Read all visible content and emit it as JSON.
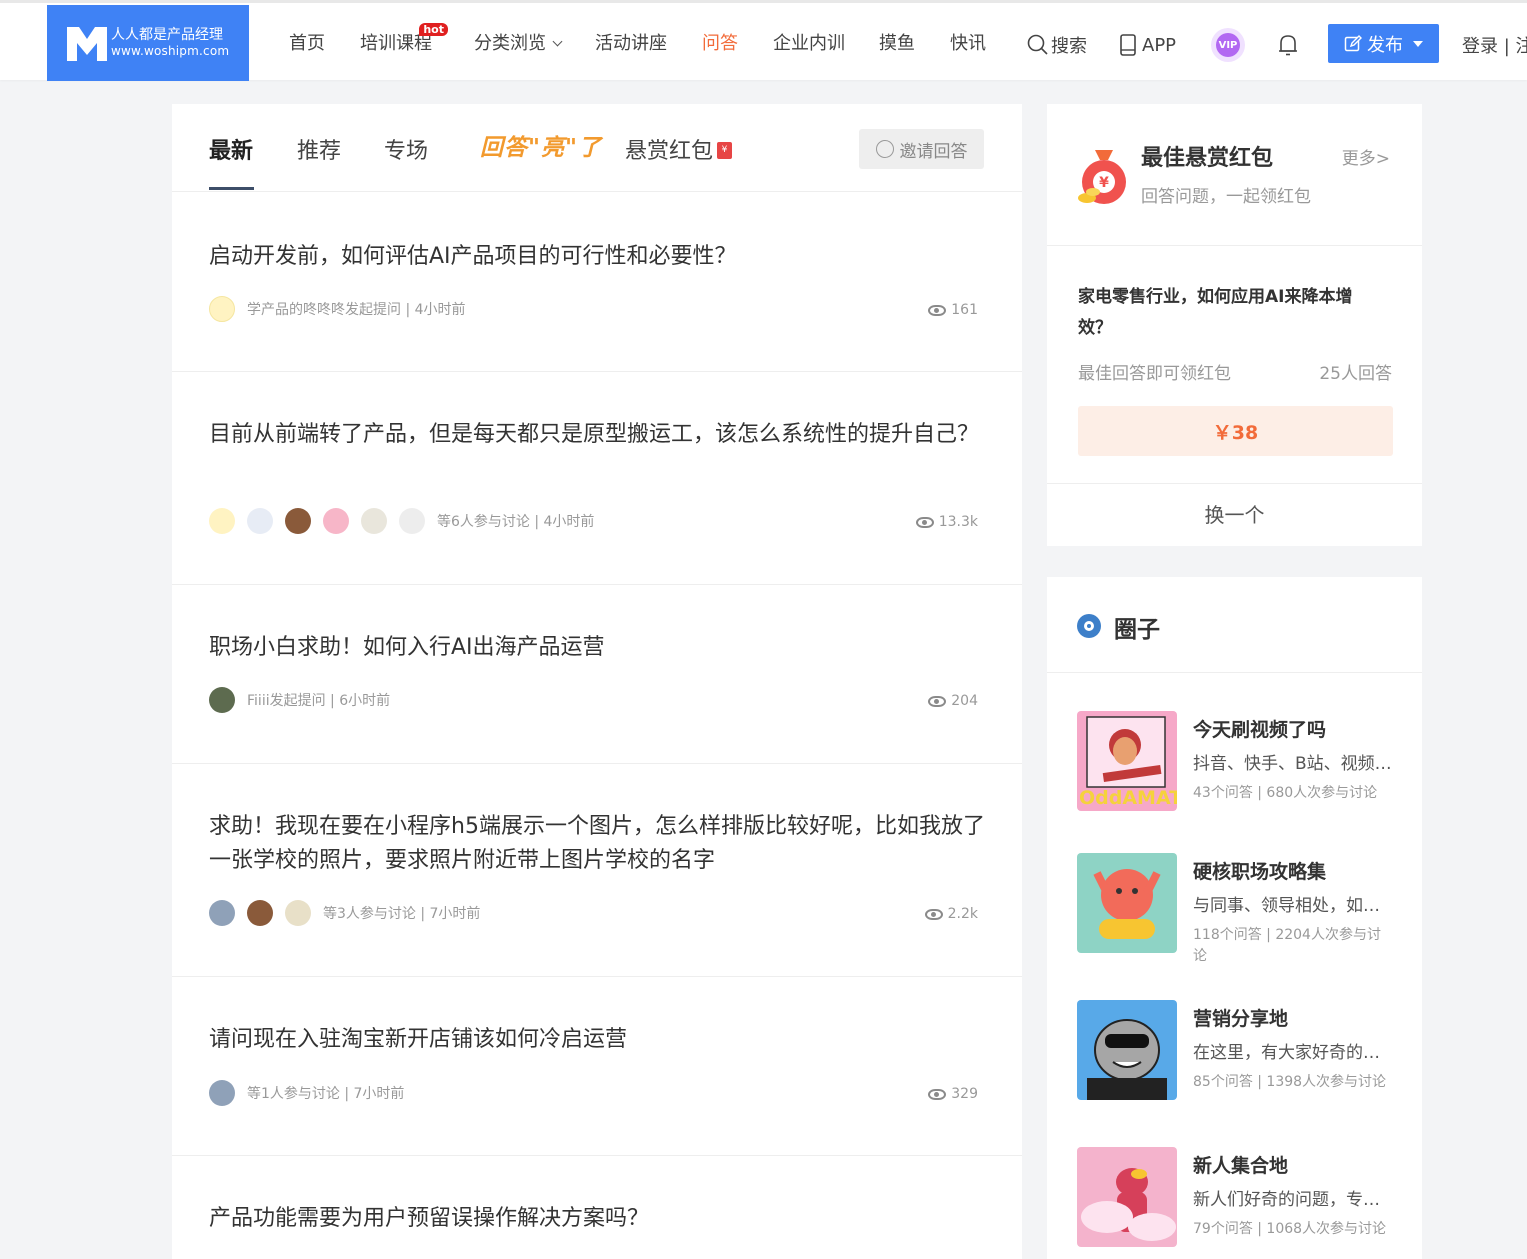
{
  "header": {
    "logo_cn": "人人都是产品经理",
    "logo_en": "www.woshipm.com",
    "nav": [
      {
        "label": "首页"
      },
      {
        "label": "培训课程",
        "badge": "hot"
      },
      {
        "label": "分类浏览"
      },
      {
        "label": "活动讲座"
      },
      {
        "label": "问答",
        "active": true
      },
      {
        "label": "企业内训"
      },
      {
        "label": "摸鱼"
      },
      {
        "label": "快讯"
      }
    ],
    "search_label": "搜索",
    "app_label": "APP",
    "vip_label": "VIP",
    "publish_label": "发布",
    "login_label": "登录 | 注"
  },
  "tabs": {
    "latest": "最新",
    "recommend": "推荐",
    "special": "专场",
    "shine": "回答\"亮\"了",
    "bounty": "悬赏红包",
    "bounty_icon": "¥",
    "invite": "邀请回答"
  },
  "questions": [
    {
      "title": "启动开发前，如何评估AI产品项目的可行性和必要性？",
      "meta": "学产品的咚咚咚发起提问 | 4小时前",
      "views": "161"
    },
    {
      "title": "目前从前端转了产品，但是每天都只是原型搬运工，该怎么系统性的提升自己？",
      "meta": "等6人参与讨论 | 4小时前",
      "views": "13.3k"
    },
    {
      "title": "职场小白求助！如何入行AI出海产品运营",
      "meta": "Fiiii发起提问 | 6小时前",
      "views": "204"
    },
    {
      "title": "求助！我现在要在小程序h5端展示一个图片，怎么样排版比较好呢，比如我放了一张学校的照片，要求照片附近带上图片学校的名字",
      "meta": "等3人参与讨论 | 7小时前",
      "views": "2.2k"
    },
    {
      "title": "请问现在入驻淘宝新开店铺该如何冷启运营",
      "meta": "等1人参与讨论 | 7小时前",
      "views": "329"
    },
    {
      "title": "产品功能需要为用户预留误操作解决方案吗？",
      "meta": "",
      "views": ""
    }
  ],
  "bounty_card": {
    "title": "最佳悬赏红包",
    "subtitle": "回答问题，一起领红包",
    "more": "更多>",
    "question": "家电零售行业，如何应用AI来降本增效？",
    "reward_text": "最佳回答即可领红包",
    "answer_count": "25人回答",
    "amount": "￥38",
    "swap": "换一个"
  },
  "groups_card": {
    "title": "圈子",
    "items": [
      {
        "name": "今天刷视频了吗",
        "desc": "抖音、快手、B站、视频号…",
        "stat": "43个问答 | 680人次参与讨论"
      },
      {
        "name": "硬核职场攻略集",
        "desc": "与同事、领导相处，如何…",
        "stat": "118个问答 | 2204人次参与讨论"
      },
      {
        "name": "营销分享地",
        "desc": "在这里，有大家好奇的营销…",
        "stat": "85个问答 | 1398人次参与讨论"
      },
      {
        "name": "新人集合地",
        "desc": "新人们好奇的问题，专属…",
        "stat": "79个问答 | 1068人次参与讨论"
      }
    ]
  },
  "colors": {
    "brand_blue": "#3f82f5",
    "active_orange": "#f26b3a",
    "hot_red": "#e02020"
  }
}
